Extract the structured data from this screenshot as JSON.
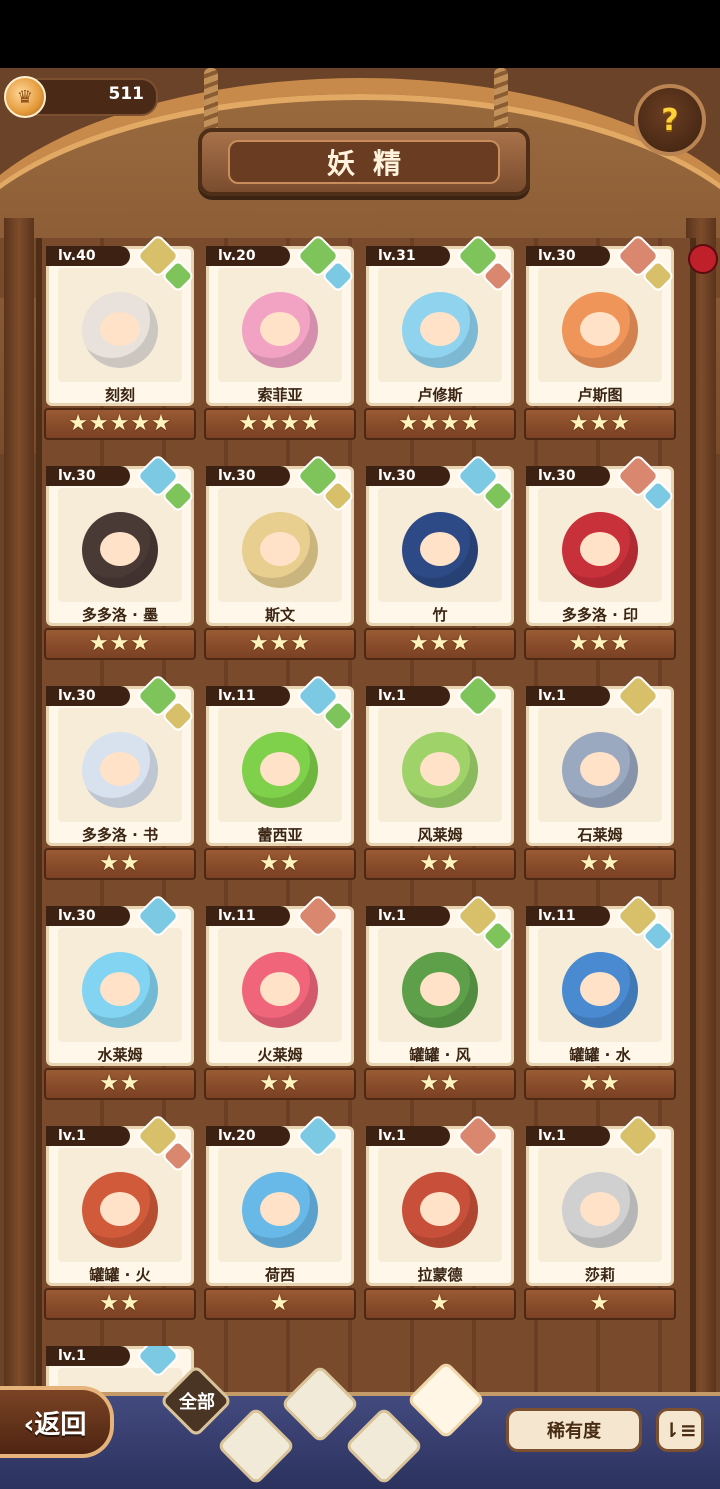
{
  "currency": {
    "amount": "511"
  },
  "header": {
    "title": "妖精",
    "help_label": "?"
  },
  "cards": [
    {
      "level": "lv.40",
      "name": "刻刻",
      "stars": "★★★★★",
      "elements": [
        "earth",
        "grass"
      ]
    },
    {
      "level": "lv.20",
      "name": "索菲亚",
      "stars": "★★★★",
      "elements": [
        "grass",
        "water"
      ]
    },
    {
      "level": "lv.31",
      "name": "卢修斯",
      "stars": "★★★★",
      "elements": [
        "grass",
        "fire"
      ]
    },
    {
      "level": "lv.30",
      "name": "卢斯图",
      "stars": "★★★",
      "elements": [
        "fire",
        "earth"
      ]
    },
    {
      "level": "lv.30",
      "name": "多多洛 · 墨",
      "stars": "★★★",
      "elements": [
        "water",
        "grass"
      ]
    },
    {
      "level": "lv.30",
      "name": "斯文",
      "stars": "★★★",
      "elements": [
        "grass",
        "earth"
      ]
    },
    {
      "level": "lv.30",
      "name": "竹",
      "stars": "★★★",
      "elements": [
        "water",
        "grass"
      ]
    },
    {
      "level": "lv.30",
      "name": "多多洛 · 印",
      "stars": "★★★",
      "elements": [
        "fire",
        "water"
      ]
    },
    {
      "level": "lv.30",
      "name": "多多洛 · 书",
      "stars": "★★",
      "elements": [
        "grass",
        "earth"
      ]
    },
    {
      "level": "lv.11",
      "name": "蕾西亚",
      "stars": "★★",
      "elements": [
        "water",
        "grass"
      ]
    },
    {
      "level": "lv.1",
      "name": "风莱姆",
      "stars": "★★",
      "elements": [
        "grass"
      ]
    },
    {
      "level": "lv.1",
      "name": "石莱姆",
      "stars": "★★",
      "elements": [
        "earth"
      ]
    },
    {
      "level": "lv.30",
      "name": "水莱姆",
      "stars": "★★",
      "elements": [
        "water"
      ]
    },
    {
      "level": "lv.11",
      "name": "火莱姆",
      "stars": "★★",
      "elements": [
        "fire"
      ]
    },
    {
      "level": "lv.1",
      "name": "罐罐 · 风",
      "stars": "★★",
      "elements": [
        "earth",
        "grass"
      ]
    },
    {
      "level": "lv.11",
      "name": "罐罐 · 水",
      "stars": "★★",
      "elements": [
        "earth",
        "water"
      ]
    },
    {
      "level": "lv.1",
      "name": "罐罐 · 火",
      "stars": "★★",
      "elements": [
        "earth",
        "fire"
      ]
    },
    {
      "level": "lv.20",
      "name": "荷西",
      "stars": "★",
      "elements": [
        "water"
      ]
    },
    {
      "level": "lv.1",
      "name": "拉蒙德",
      "stars": "★",
      "elements": [
        "fire"
      ]
    },
    {
      "level": "lv.1",
      "name": "莎莉",
      "stars": "★",
      "elements": [
        "earth"
      ]
    },
    {
      "level": "lv.1",
      "name": "",
      "stars": "",
      "elements": [
        "water"
      ]
    }
  ],
  "colors": {
    "earth": "#d8c06a",
    "grass": "#7fc45a",
    "water": "#7cc9e4",
    "fire": "#d9876e"
  },
  "art_colors": [
    "#e9e2dc",
    "#f2a3c4",
    "#8fd3ef",
    "#f0955a",
    "#4a3a36",
    "#e8cf90",
    "#2e4a86",
    "#c8303a",
    "#d8e2ee",
    "#7fd04a",
    "#9fd36a",
    "#9aa8c0",
    "#82d4f2",
    "#f0657a",
    "#5ea04a",
    "#4a8ad0",
    "#d05a3a",
    "#68b8e8",
    "#c8503a",
    "#d0d0d0",
    "#b8e0f0"
  ],
  "bottom": {
    "back_label": "返回",
    "tab_all_label": "全部",
    "rarity_label": "稀有度",
    "sort_label": "⇂≡"
  }
}
